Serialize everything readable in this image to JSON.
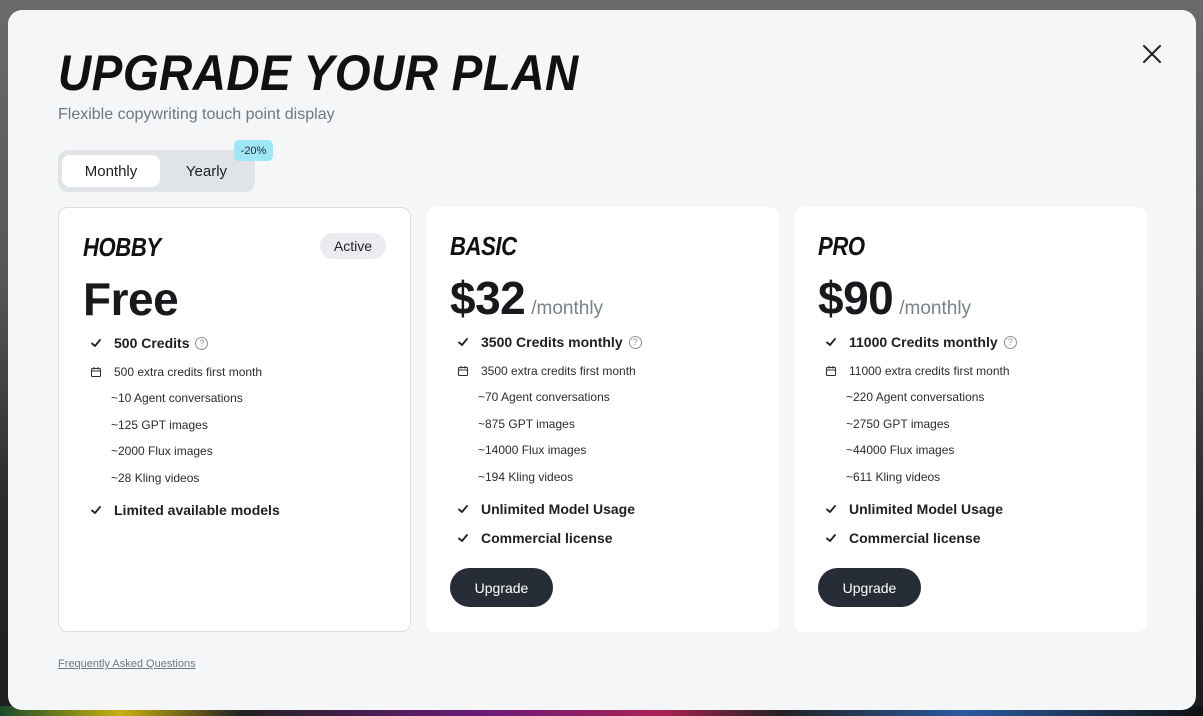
{
  "modal": {
    "title": "UPGRADE YOUR PLAN",
    "subtitle": "Flexible copywriting touch point display",
    "close_icon": "close-icon"
  },
  "billing_toggle": {
    "monthly_label": "Monthly",
    "yearly_label": "Yearly",
    "selected": "Monthly",
    "discount": "-20%"
  },
  "plans": [
    {
      "name": "HOBBY",
      "badge": "Active",
      "price": "Free",
      "period": "",
      "credits": "500 Credits",
      "extra": "500 extra credits first month",
      "usage": [
        "~10 Agent conversations",
        "~125 GPT images",
        "~2000 Flux images",
        "~28 Kling videos"
      ],
      "features": [
        "Limited available models"
      ],
      "button": ""
    },
    {
      "name": "BASIC",
      "badge": "",
      "price": "$32",
      "period": "/monthly",
      "credits": "3500 Credits monthly",
      "extra": "3500 extra credits first month",
      "usage": [
        "~70 Agent conversations",
        "~875 GPT images",
        "~14000 Flux images",
        "~194 Kling videos"
      ],
      "features": [
        "Unlimited Model Usage",
        "Commercial license"
      ],
      "button": "Upgrade"
    },
    {
      "name": "PRO",
      "badge": "",
      "price": "$90",
      "period": "/monthly",
      "credits": "11000 Credits monthly",
      "extra": "11000 extra credits first month",
      "usage": [
        "~220 Agent conversations",
        "~2750 GPT images",
        "~44000 Flux images",
        "~611 Kling videos"
      ],
      "features": [
        "Unlimited Model Usage",
        "Commercial license"
      ],
      "button": "Upgrade"
    }
  ],
  "footer": {
    "faq_link": "Frequently Asked Questions"
  },
  "colors": {
    "modal_bg": "#f4f6f8",
    "card_bg": "#ffffff",
    "button_bg": "#272d36",
    "discount_badge": "#9fe6f7",
    "toggle_bg": "#e0e3e7"
  }
}
